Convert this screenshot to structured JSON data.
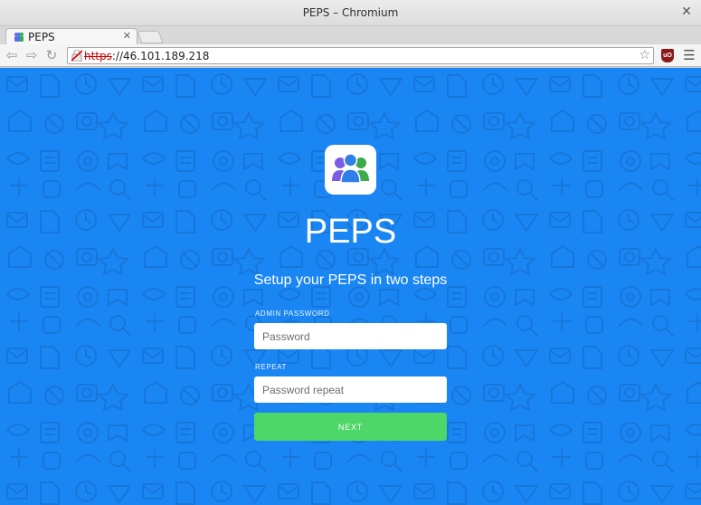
{
  "window": {
    "title": "PEPS – Chromium"
  },
  "tabs": [
    {
      "label": "PEPS"
    }
  ],
  "address_bar": {
    "scheme": "https",
    "rest": "://46.101.189.218"
  },
  "page": {
    "app_name": "PEPS",
    "subtitle": "Setup your PEPS in two steps",
    "admin_password": {
      "label": "ADMIN PASSWORD",
      "placeholder": "Password",
      "value": ""
    },
    "repeat": {
      "label": "REPEAT",
      "placeholder": "Password repeat",
      "value": ""
    },
    "next_label": "NEXT"
  },
  "colors": {
    "background": "#1a86f4",
    "button": "#4cd768",
    "logo_people": [
      "#7b5ce6",
      "#2f7fe8",
      "#3aaa4a"
    ]
  },
  "icons": {
    "tab_close": "close-icon",
    "window_close": "close-icon",
    "back": "back-arrow-icon",
    "forward": "forward-arrow-icon",
    "reload": "reload-icon",
    "bookmark": "star-icon",
    "extension": "ublock-icon",
    "menu": "hamburger-menu-icon"
  }
}
